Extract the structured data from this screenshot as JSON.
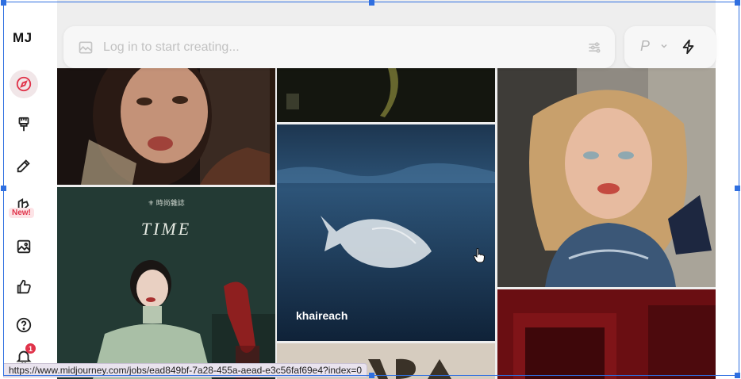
{
  "sidebar": {
    "logo": "MJ",
    "new_badge": "New!",
    "notification_count": "1"
  },
  "search": {
    "placeholder": "Log in to start creating..."
  },
  "mode": {
    "selected": "P"
  },
  "gallery": {
    "creator_label": "khaireach",
    "poster_title": "TIME",
    "poster_subtitle": "⚜ 時尚雜誌"
  },
  "status": {
    "url": "https://www.midjourney.com/jobs/ead849bf-7a28-455a-aead-e3c56faf69e4?index=0"
  },
  "colors": {
    "accent": "#e0334a",
    "active_bg": "#f1e6e8"
  }
}
